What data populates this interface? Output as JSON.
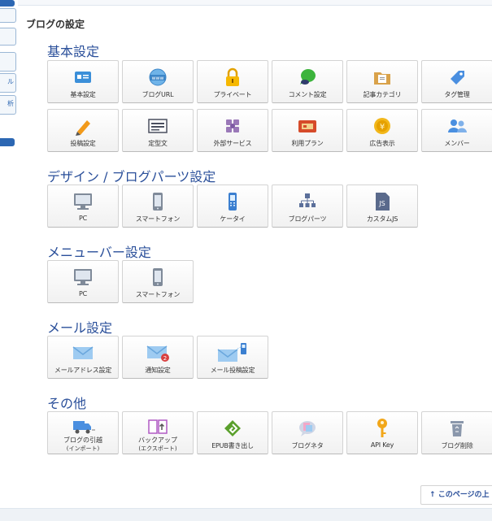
{
  "page_title": "ブログの設定",
  "sidebar": {
    "tab1": "ル",
    "tab2": "析"
  },
  "sections": {
    "basic": {
      "title": "基本設定",
      "tiles": [
        {
          "label": "基本設定",
          "icon": "id-card-icon"
        },
        {
          "label": "ブログURL",
          "icon": "www-globe-icon"
        },
        {
          "label": "プライベート",
          "icon": "padlock-icon"
        },
        {
          "label": "コメント設定",
          "icon": "speech-bubble-icon"
        },
        {
          "label": "記事カテゴリ",
          "icon": "folder-icon"
        },
        {
          "label": "タグ管理",
          "icon": "tag-icon"
        },
        {
          "label": "投稿設定",
          "icon": "pencil-icon"
        },
        {
          "label": "定型文",
          "icon": "template-icon"
        },
        {
          "label": "外部サービス",
          "icon": "puzzle-icon"
        },
        {
          "label": "利用プラン",
          "icon": "plan-card-icon"
        },
        {
          "label": "広告表示",
          "icon": "coin-icon"
        },
        {
          "label": "メンバー",
          "icon": "members-icon"
        }
      ]
    },
    "design": {
      "title": "デザイン / ブログパーツ設定",
      "tiles": [
        {
          "label": "PC",
          "icon": "monitor-icon"
        },
        {
          "label": "スマートフォン",
          "icon": "smartphone-icon"
        },
        {
          "label": "ケータイ",
          "icon": "feature-phone-icon"
        },
        {
          "label": "ブログパーツ",
          "icon": "blog-parts-icon"
        },
        {
          "label": "カスタムJS",
          "icon": "js-file-icon"
        }
      ]
    },
    "menubar": {
      "title": "メニューバー設定",
      "tiles": [
        {
          "label": "PC",
          "icon": "monitor-icon"
        },
        {
          "label": "スマートフォン",
          "icon": "smartphone-icon"
        }
      ]
    },
    "mail": {
      "title": "メール設定",
      "tiles": [
        {
          "label": "メールアドレス設定",
          "icon": "envelope-icon"
        },
        {
          "label": "通知設定",
          "icon": "notify-envelope-icon",
          "badge": "2"
        },
        {
          "label": "メール投稿設定",
          "icon": "mail-phone-icon"
        }
      ]
    },
    "other": {
      "title": "その他",
      "tiles": [
        {
          "label": "ブログの引越",
          "sub": "(インポート)",
          "icon": "truck-icon"
        },
        {
          "label": "バックアップ",
          "sub": "(エクスポート)",
          "icon": "backup-book-icon"
        },
        {
          "label": "EPUB書き出し",
          "icon": "epub-icon"
        },
        {
          "label": "ブログネタ",
          "icon": "blog-neta-icon"
        },
        {
          "label": "API Key",
          "icon": "key-icon"
        },
        {
          "label": "ブログ削除",
          "icon": "trash-icon"
        }
      ]
    }
  },
  "pagetop": {
    "arrow": "↑",
    "label": "このページの上"
  },
  "colors": {
    "accent": "#2a4f9a",
    "link_blue": "#2c67b3"
  }
}
